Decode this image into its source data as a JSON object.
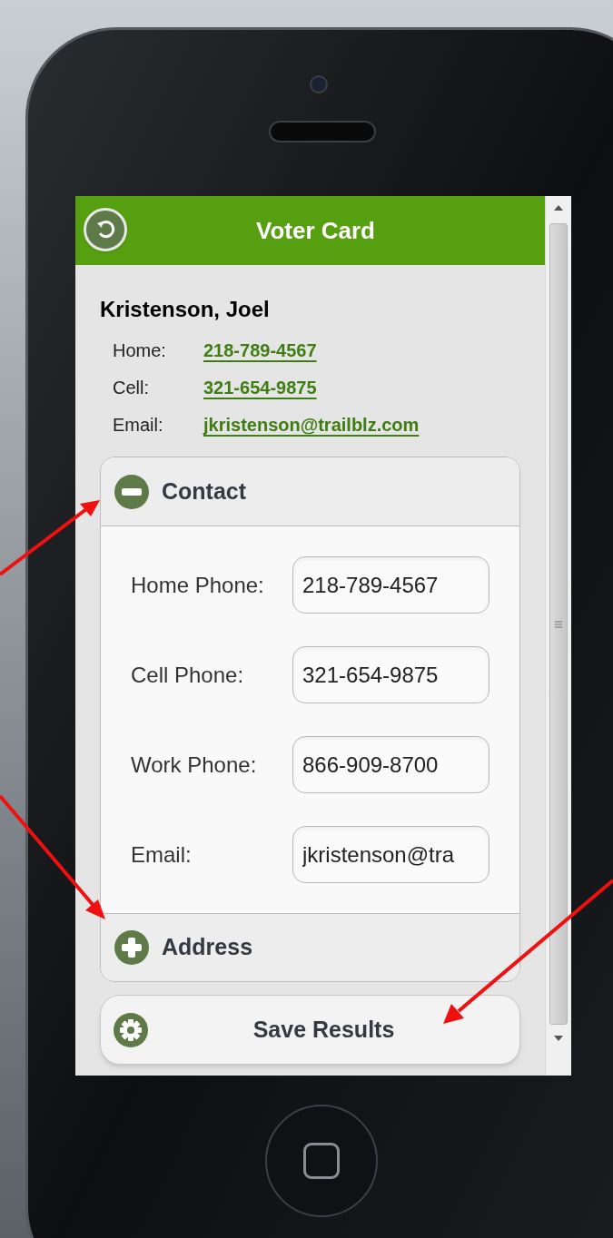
{
  "header": {
    "title": "Voter Card"
  },
  "voter": {
    "name": "Kristenson, Joel",
    "details": [
      {
        "label": "Home:",
        "value": "218-789-4567"
      },
      {
        "label": "Cell:",
        "value": "321-654-9875"
      },
      {
        "label": "Email:",
        "value": "jkristenson@trailblz.com"
      }
    ]
  },
  "sections": [
    {
      "title": "Contact",
      "expanded": true,
      "fields": [
        {
          "label": "Home Phone:",
          "value": "218-789-4567"
        },
        {
          "label": "Cell Phone:",
          "value": "321-654-9875"
        },
        {
          "label": "Work Phone:",
          "value": "866-909-8700"
        },
        {
          "label": "Email:",
          "value": "jkristenson@tra"
        }
      ]
    },
    {
      "title": "Address",
      "expanded": false
    }
  ],
  "save_button": {
    "label": "Save Results"
  }
}
